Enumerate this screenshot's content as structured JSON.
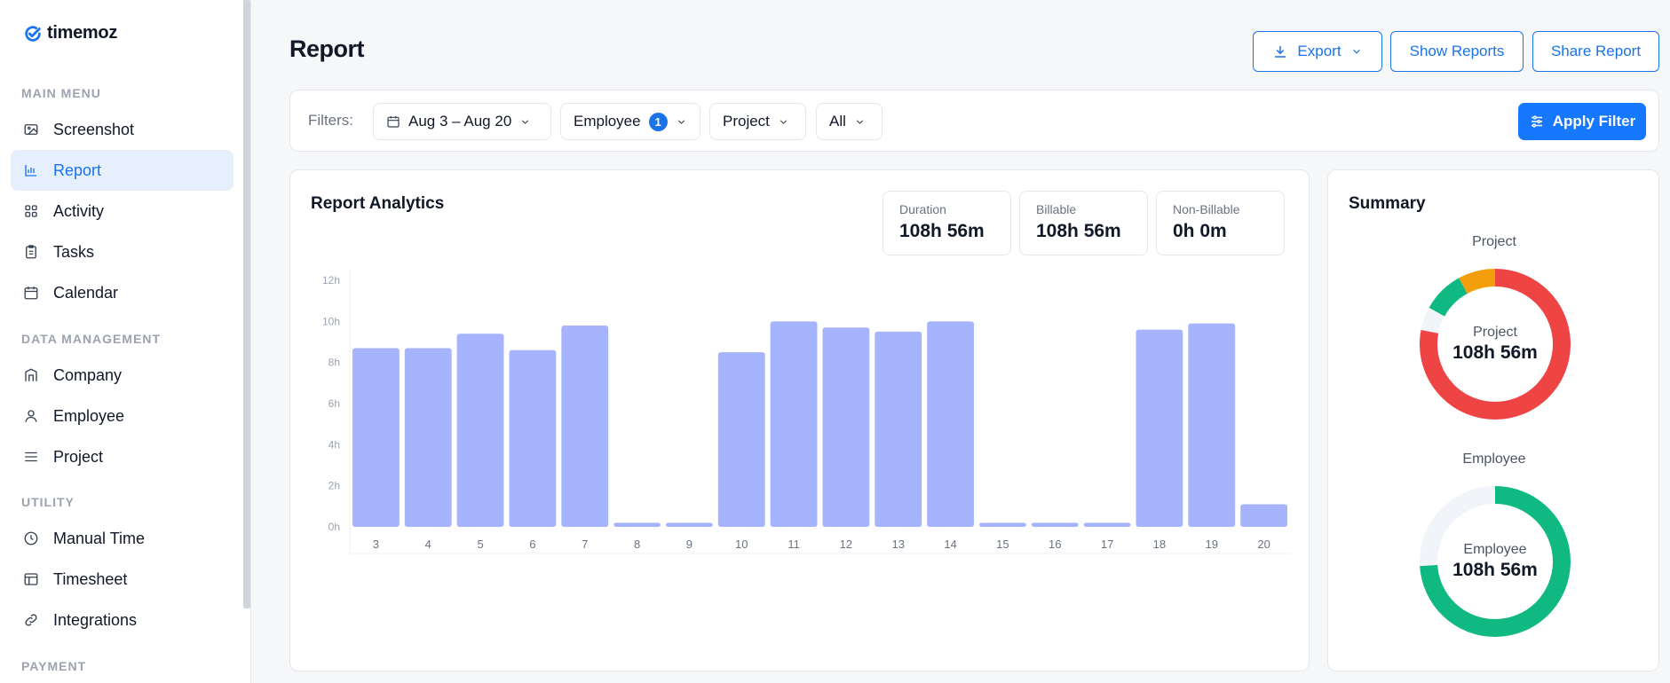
{
  "app": {
    "name": "timemoz"
  },
  "sidebar": {
    "sections": {
      "main": "MAIN MENU",
      "data": "DATA MANAGEMENT",
      "utility": "UTILITY",
      "payment": "PAYMENT"
    },
    "items": [
      {
        "label": "Screenshot",
        "icon": "image-icon"
      },
      {
        "label": "Report",
        "icon": "bar-chart-icon",
        "active": true
      },
      {
        "label": "Activity",
        "icon": "grid-icon"
      },
      {
        "label": "Tasks",
        "icon": "clipboard-icon"
      },
      {
        "label": "Calendar",
        "icon": "calendar-icon"
      },
      {
        "label": "Company",
        "icon": "building-icon"
      },
      {
        "label": "Employee",
        "icon": "user-icon"
      },
      {
        "label": "Project",
        "icon": "list-icon"
      },
      {
        "label": "Manual Time",
        "icon": "clock-icon"
      },
      {
        "label": "Timesheet",
        "icon": "table-icon"
      },
      {
        "label": "Integrations",
        "icon": "link-icon"
      }
    ]
  },
  "header": {
    "title": "Report",
    "export_label": "Export",
    "show_reports_label": "Show Reports",
    "share_report_label": "Share Report"
  },
  "filters": {
    "label": "Filters:",
    "date_range": "Aug 3 – Aug 20",
    "employee_label": "Employee",
    "employee_count": "1",
    "project_label": "Project",
    "all_label": "All",
    "apply_label": "Apply Filter"
  },
  "analytics": {
    "title": "Report Analytics",
    "stats": [
      {
        "label": "Duration",
        "value": "108h 56m"
      },
      {
        "label": "Billable",
        "value": "108h 56m"
      },
      {
        "label": "Non-Billable",
        "value": "0h 0m"
      }
    ]
  },
  "chart_data": {
    "type": "bar",
    "categories": [
      "3",
      "4",
      "5",
      "6",
      "7",
      "8",
      "9",
      "10",
      "11",
      "12",
      "13",
      "14",
      "15",
      "16",
      "17",
      "18",
      "19",
      "20"
    ],
    "values": [
      8.7,
      8.7,
      9.4,
      8.6,
      9.8,
      0.2,
      0.2,
      8.5,
      10.0,
      9.7,
      9.5,
      10.0,
      0.2,
      0.2,
      0.2,
      9.6,
      9.9,
      1.1
    ],
    "y_ticks": [
      "0h",
      "2h",
      "4h",
      "6h",
      "8h",
      "10h",
      "12h"
    ],
    "ylim": [
      0,
      12
    ],
    "bar_color": "#a5b4fc"
  },
  "summary": {
    "title": "Summary",
    "project": {
      "title": "Project",
      "center_label": "Project",
      "center_value": "108h 56m",
      "segments": [
        {
          "color": "#ef4444",
          "fraction": 0.78
        },
        {
          "color": "#f1f5f9",
          "fraction": 0.05
        },
        {
          "color": "#10b981",
          "fraction": 0.09
        },
        {
          "color": "#f59e0b",
          "fraction": 0.08
        }
      ]
    },
    "employee": {
      "title": "Employee",
      "center_label": "Employee",
      "center_value": "108h 56m",
      "segments": [
        {
          "color": "#10b981",
          "fraction": 0.74
        },
        {
          "color": "#f1f5f9",
          "fraction": 0.26
        }
      ]
    }
  },
  "colors": {
    "accent": "#1a73e8",
    "bar": "#a5b4fc"
  }
}
